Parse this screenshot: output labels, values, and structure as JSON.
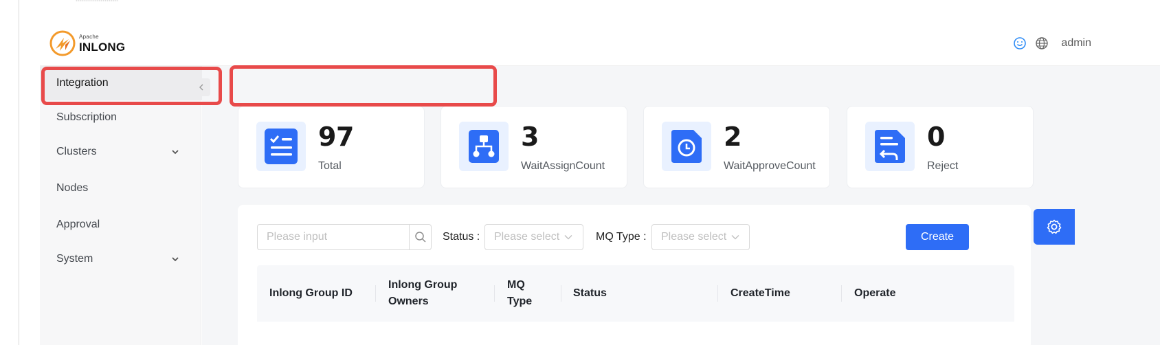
{
  "header": {
    "logo_small": "Apache",
    "logo_big": "INLONG",
    "user": "admin",
    "icons": [
      "smile-icon",
      "globe-icon"
    ]
  },
  "sidebar": {
    "items": [
      {
        "label": "Integration",
        "active": true
      },
      {
        "label": "Subscription"
      },
      {
        "label": "Clusters",
        "has_submenu": true
      },
      {
        "label": "Nodes"
      },
      {
        "label": "Approval"
      },
      {
        "label": "System",
        "has_submenu": true
      }
    ]
  },
  "stats": [
    {
      "value": "97",
      "label": "Total",
      "icon": "checklist-icon"
    },
    {
      "value": "3",
      "label": "WaitAssignCount",
      "icon": "hierarchy-icon"
    },
    {
      "value": "2",
      "label": "WaitApproveCount",
      "icon": "clock-document-icon"
    },
    {
      "value": "0",
      "label": "Reject",
      "icon": "reject-document-icon"
    }
  ],
  "filters": {
    "search_placeholder": "Please input",
    "status_label": "Status",
    "status_placeholder": "Please select",
    "mq_label": "MQ Type",
    "mq_placeholder": "Please select",
    "create_label": "Create"
  },
  "table": {
    "columns": [
      "Inlong Group ID",
      "Inlong Group Owners",
      "MQ Type",
      "Status",
      "CreateTime",
      "Operate"
    ]
  },
  "colors": {
    "primary": "#2e6df6",
    "highlight": "#e84a4a",
    "icon_bg": "#e9f1ff"
  }
}
